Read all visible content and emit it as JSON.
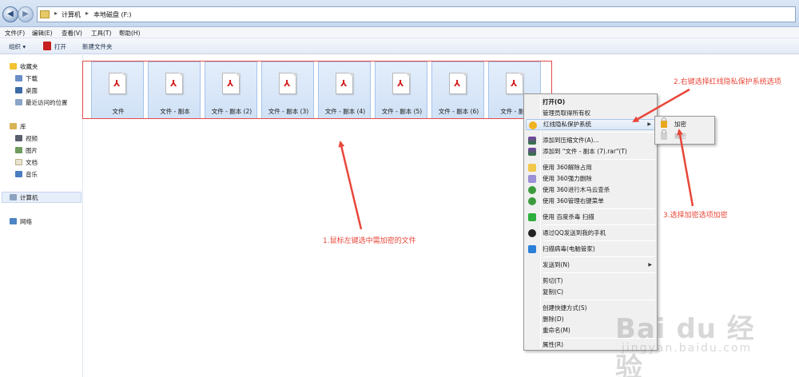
{
  "address": {
    "crumbs": [
      "计算机",
      "本地磁盘 (F:)"
    ]
  },
  "menubar": [
    "文件(F)",
    "编辑(E)",
    "查看(V)",
    "工具(T)",
    "帮助(H)"
  ],
  "toolbar": {
    "organize": "组织 ▾",
    "open": "打开",
    "new_folder": "新建文件夹"
  },
  "nav": {
    "favorites": "收藏夹",
    "downloads": "下载",
    "desktop": "桌面",
    "recent": "最近访问的位置",
    "libraries": "库",
    "videos": "视频",
    "pictures": "图片",
    "documents": "文档",
    "music": "音乐",
    "computer": "计算机",
    "network": "网络"
  },
  "files": [
    "文件",
    "文件 - 副本",
    "文件 - 副本 (2)",
    "文件 - 副本 (3)",
    "文件 - 副本 (4)",
    "文件 - 副本 (5)",
    "文件 - 副本 (6)",
    "文件 - 副本"
  ],
  "context_menu": {
    "open": "打开(O)",
    "take_ownership": "管理员取得所有权",
    "hongxian": "红线隐私保护系统",
    "add_archive": "添加到压缩文件(A)...",
    "add_rar": "添加到 \"文件 - 副本 (7).rar\"(T)",
    "unlock_360": "使用 360解除占用",
    "delete_360": "使用 360强力删除",
    "scan_360": "使用 360进行木马云查杀",
    "menu_360": "使用 360管理右键菜单",
    "baidu_scan": "使用 百度杀毒 扫描",
    "qq_send": "通过QQ发送到我的手机",
    "pc_manager": "扫描病毒(电脑管家)",
    "send_to": "发送到(N)",
    "cut": "剪切(T)",
    "copy": "复制(C)",
    "shortcut": "创建快捷方式(S)",
    "delete": "删除(D)",
    "rename": "重命名(M)",
    "properties": "属性(R)"
  },
  "submenu": {
    "encrypt": "加密",
    "decrypt": "解密"
  },
  "annotations": {
    "step1": "1.鼠标左键选中需加密的文件",
    "step2": "2.右键选择红线隐私保护系统选项",
    "step3": "3.选择加密选项加密"
  },
  "watermark": {
    "brand": "Bai du 经验",
    "url": "jingyan.baidu.com"
  },
  "colors": {
    "annotation": "#e8473a",
    "selection": "#d0e1f6",
    "pdf": "#d21f1f"
  }
}
